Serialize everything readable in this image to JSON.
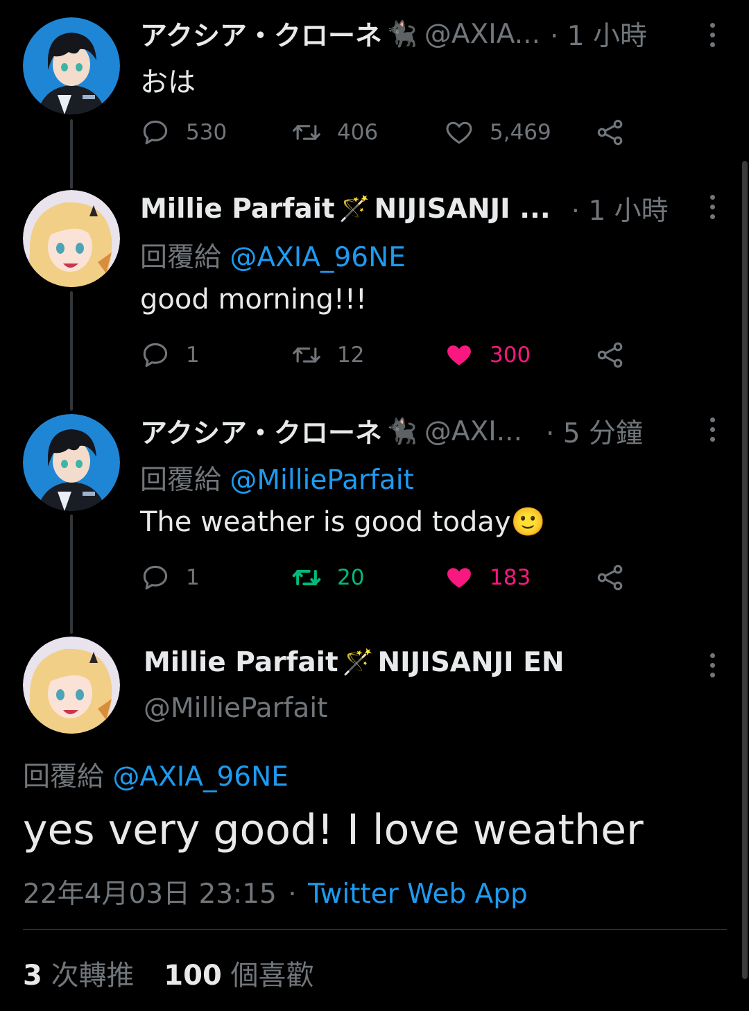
{
  "tweets": [
    {
      "name": "アクシア・クローネ",
      "name_emoji": "🐈‍⬛",
      "handle": "@AXIA...",
      "time": "· 1 小時",
      "reply_prefix": "",
      "reply_mention": "",
      "text": "おは",
      "replies": "530",
      "retweets": "406",
      "likes": "5,469",
      "liked": false,
      "retweeted": false
    },
    {
      "name": "Millie Parfait",
      "name_emoji": "🪄",
      "handle": "NIJISANJI ...",
      "time": "· 1 小時",
      "reply_prefix": "回覆給 ",
      "reply_mention": "@AXIA_96NE",
      "text": "good morning!!!",
      "replies": "1",
      "retweets": "12",
      "likes": "300",
      "liked": true,
      "retweeted": false
    },
    {
      "name": "アクシア・クローネ",
      "name_emoji": "🐈‍⬛",
      "handle": "@AXI...",
      "time": "· 5 分鐘",
      "reply_prefix": "回覆給 ",
      "reply_mention": "@MillieParfait",
      "text": "The weather is good today",
      "text_emoji": "🙂",
      "replies": "1",
      "retweets": "20",
      "likes": "183",
      "liked": true,
      "retweeted": true
    }
  ],
  "focused": {
    "name": "Millie Parfait",
    "name_emoji": "🪄",
    "name_suffix": "NIJISANJI EN",
    "handle": "@MillieParfait",
    "reply_prefix": "回覆給 ",
    "reply_mention": "@AXIA_96NE",
    "text": "yes very good! I love weather",
    "date": "22年4月03日 23:15",
    "separator": "·",
    "source": "Twitter Web App",
    "retweet_count": "3",
    "retweet_label": "次轉推",
    "like_count": "100",
    "like_label": "個喜歡"
  },
  "colors": {
    "background": "#000000",
    "text": "#e7e9ea",
    "muted": "#71767b",
    "link": "#1d9bf0",
    "like": "#f91880",
    "retweet": "#00ba7c"
  },
  "icons": [
    "reply-icon",
    "retweet-icon",
    "like-icon",
    "share-icon",
    "more-icon"
  ]
}
